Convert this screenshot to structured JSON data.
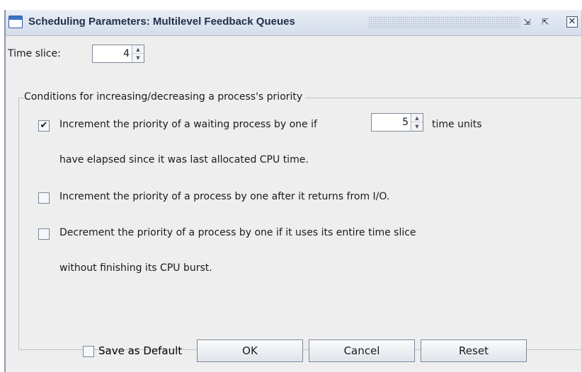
{
  "window": {
    "title": "Scheduling Parameters: Multilevel Feedback Queues",
    "restore_icon": "restore-icon",
    "maximize_icon": "maximize-icon",
    "close_icon": "close-icon"
  },
  "time_slice": {
    "label": "Time slice:",
    "value": "4"
  },
  "conditions": {
    "legend": "Conditions for increasing/decreasing a process's priority",
    "option1": {
      "checked": true,
      "text_before": "Increment the priority of a waiting process by one if",
      "value": "5",
      "text_after": "time units",
      "text_line2": "have elapsed since it was last allocated CPU time."
    },
    "option2": {
      "checked": false,
      "text": "Increment the priority of a process by one after it returns from I/O."
    },
    "option3": {
      "checked": false,
      "text_line1": "Decrement the priority of a process by one if it uses its entire time slice",
      "text_line2": "without finishing its CPU burst."
    }
  },
  "footer": {
    "save_default": {
      "checked": false,
      "label": "Save as Default"
    },
    "ok_label": "OK",
    "cancel_label": "Cancel",
    "reset_label": "Reset"
  }
}
